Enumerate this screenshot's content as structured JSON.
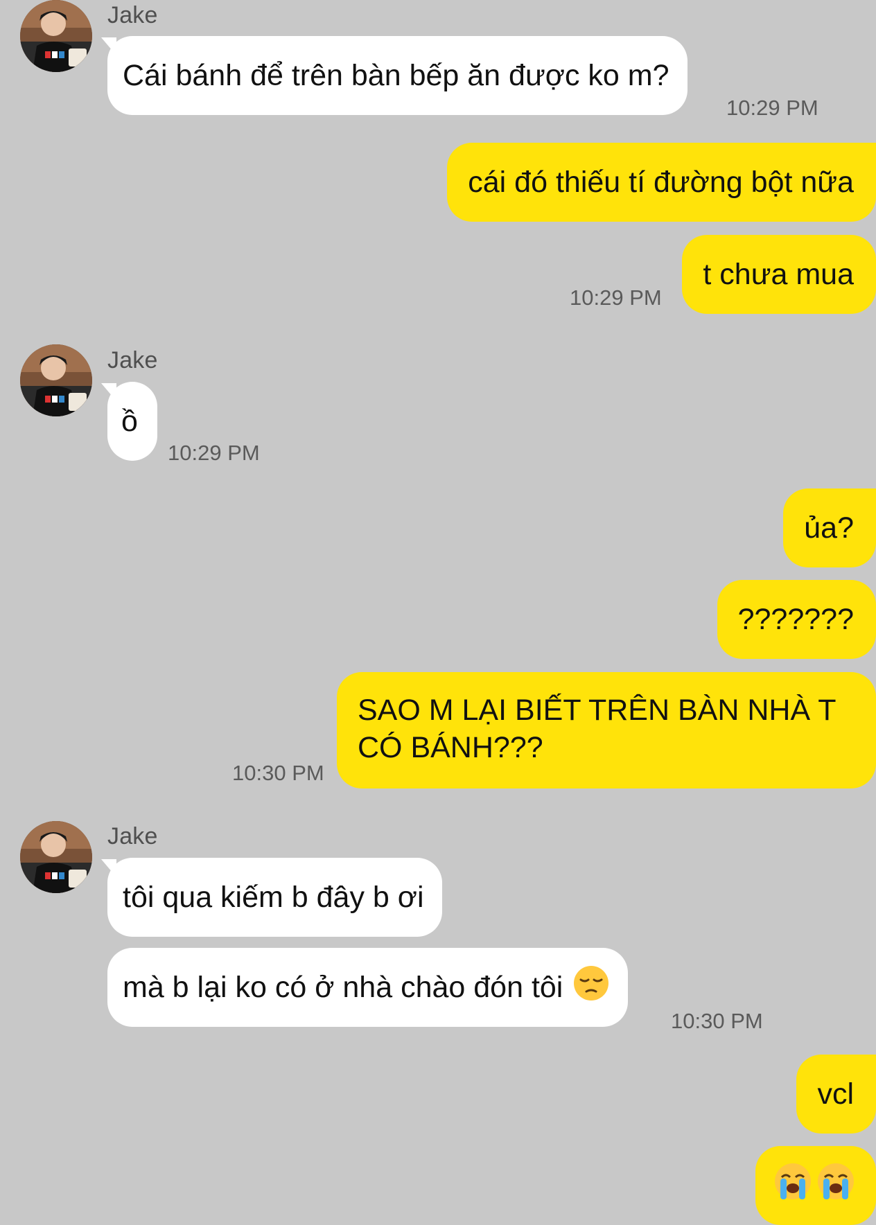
{
  "chat": {
    "groups": [
      {
        "sender": "Jake",
        "messages": [
          "Cái bánh để trên bàn bếp ăn được ko m?"
        ],
        "time": "10:29 PM"
      },
      {
        "messages_out": [
          "cái đó thiếu tí đường bột nữa",
          "t chưa mua"
        ],
        "time": "10:29 PM"
      },
      {
        "sender": "Jake",
        "messages": [
          "ồ"
        ],
        "time": "10:29 PM"
      },
      {
        "messages_out": [
          "ủa?",
          "???????",
          "SAO M LẠI BIẾT TRÊN BÀN NHÀ T CÓ BÁNH???"
        ],
        "time": "10:30 PM"
      },
      {
        "sender": "Jake",
        "messages": [
          "tôi qua kiếm b đây b ơi",
          "mà b lại ko có ở nhà chào đón tôi"
        ],
        "emoji": "pensive-face",
        "time": "10:30 PM"
      },
      {
        "messages_out": [
          "vcl"
        ],
        "emoji_out": [
          "loudly-crying-face",
          "loudly-crying-face"
        ]
      }
    ]
  },
  "colors": {
    "background": "#c8c8c8",
    "incoming_bubble": "#ffffff",
    "outgoing_bubble": "#ffe30a",
    "timestamp": "#5a5a5a"
  }
}
